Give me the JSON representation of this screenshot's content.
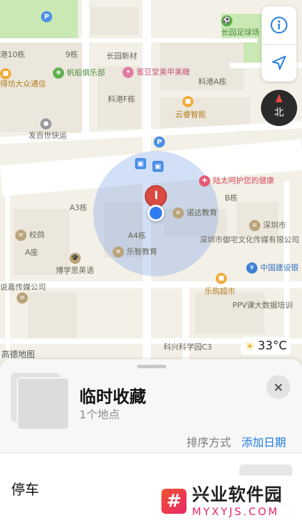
{
  "map": {
    "labels": [
      "港10栋",
      "9栋",
      "长园新材",
      "蜜豆堂美甲美睫",
      "料港A栋",
      "长园足球场",
      "帆船俱乐部",
      "得坊大众通信",
      "料港F栋",
      "云睿智能",
      "发百世快运",
      "陆太呵护您的健康",
      "A3栋",
      "诺达教育",
      "B栋",
      "深圳市",
      "校鸽",
      "A座",
      "A4栋",
      "乐智教育",
      "深圳市御宅文化传媒有限公司",
      "博学思英语",
      "中国建设银",
      "说嘉传媒公司",
      "乐购超市",
      "PPV课大数据培训",
      "科兴科学园C3"
    ],
    "weather": {
      "temp": "33°C",
      "icon": "sun-icon"
    },
    "logo": "高德地图",
    "compass_label": "北"
  },
  "collection": {
    "title": "临时收藏",
    "count": "1个地点",
    "sort_label": "排序方式",
    "sort_value": "添加日期",
    "close_icon": "×",
    "items": [
      {
        "label": "停车"
      }
    ]
  },
  "watermark": {
    "logo_glyph": "#",
    "title": "兴业软件园",
    "url": "MYXYJS.COM"
  },
  "colors": {
    "accent": "#1f7de0",
    "pin": "#d94b43",
    "location": "#2f7bf0"
  }
}
